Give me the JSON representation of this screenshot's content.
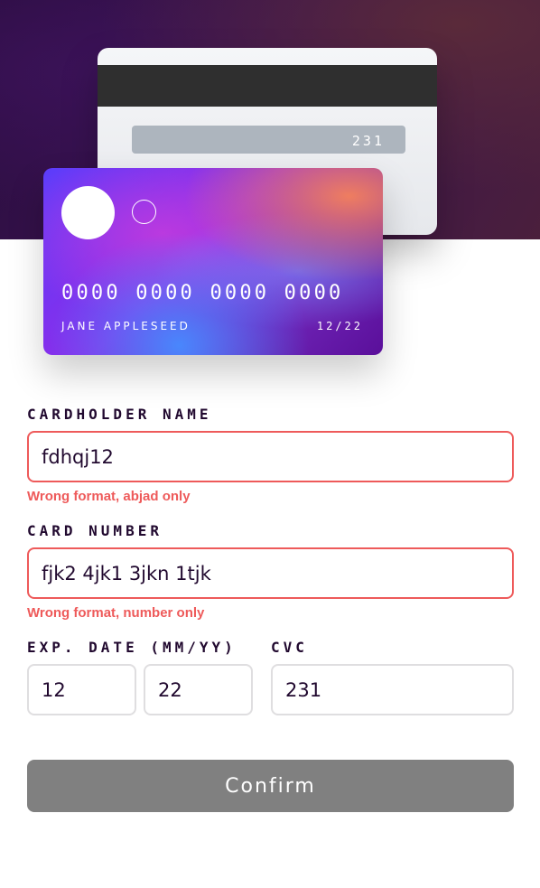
{
  "card_back": {
    "cvc": "231"
  },
  "card_front": {
    "number": "0000 0000 0000 0000",
    "holder": "JANE APPLESEED",
    "expiry": "12/22"
  },
  "form": {
    "cardholder": {
      "label": "CARDHOLDER NAME",
      "value": "fdhqj12",
      "error": "Wrong format, abjad only"
    },
    "card_number": {
      "label": "CARD NUMBER",
      "value": "fjk2 4jk1 3jkn 1tjk",
      "error": "Wrong format, number only"
    },
    "exp_date": {
      "label": "EXP. DATE (MM/YY)",
      "month": "12",
      "year": "22"
    },
    "cvc": {
      "label": "CVC",
      "value": "231"
    },
    "confirm_label": "Confirm"
  },
  "colors": {
    "error": "#ee5a5a",
    "label": "#21092f",
    "button": "#808080"
  }
}
